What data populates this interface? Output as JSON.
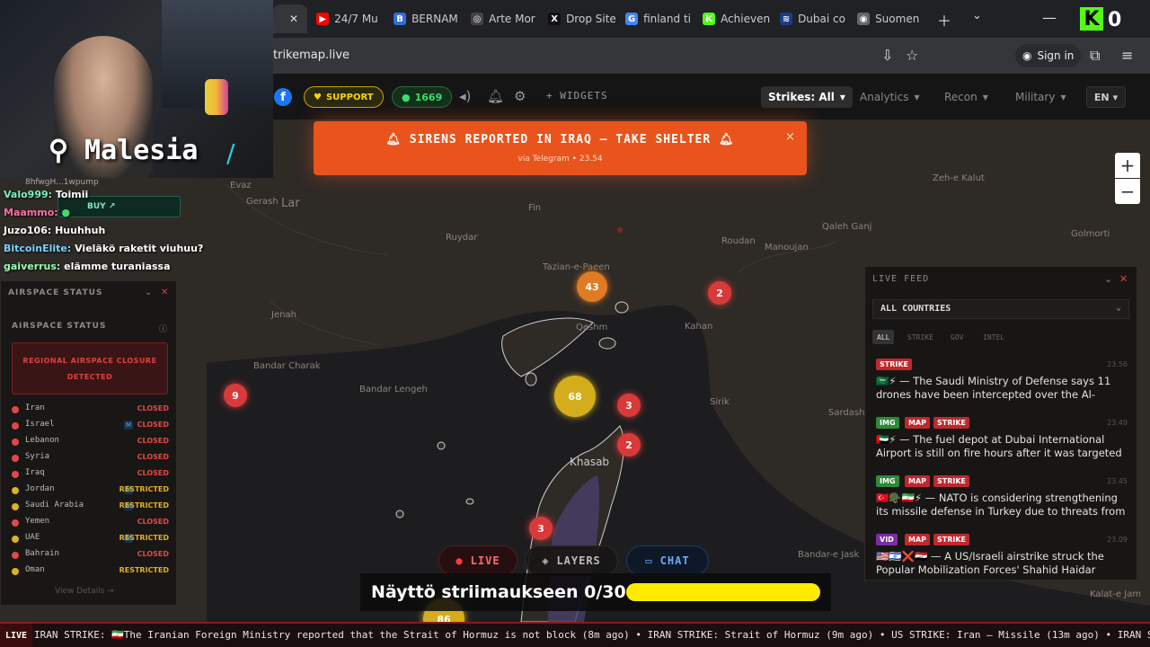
{
  "browser": {
    "tabs": [
      {
        "label": "",
        "color": "#e53935",
        "glyph": "",
        "active": true
      },
      {
        "label": "24/7 Mu",
        "color": "#ff0000",
        "glyph": "▶"
      },
      {
        "label": "BERNAM",
        "color": "#2f6fd6",
        "glyph": "B"
      },
      {
        "label": "Arte Mor",
        "color": "#444",
        "glyph": "◎"
      },
      {
        "label": "Drop Site",
        "color": "#111",
        "glyph": "X"
      },
      {
        "label": "finland ti",
        "color": "#4285f4",
        "glyph": "G"
      },
      {
        "label": "Achieven",
        "color": "#53fc18",
        "glyph": "K"
      },
      {
        "label": "Dubai co",
        "color": "#1a3c8a",
        "glyph": "≋"
      },
      {
        "label": "Suomen",
        "color": "#666",
        "glyph": "◉"
      }
    ],
    "url": "trikemap.live",
    "sign_in": "Sign in",
    "kick_count": "0"
  },
  "header": {
    "support": "SUPPORT",
    "online_count": "1669",
    "widgets": "+ WIDGETS",
    "nav": [
      {
        "label": "Strikes: All",
        "active": true
      },
      {
        "label": "Analytics"
      },
      {
        "label": "Recon"
      },
      {
        "label": "Military"
      }
    ],
    "lang": "EN"
  },
  "alert": {
    "title": "SIRENS REPORTED IN IRAQ — TAKE SHELTER",
    "sub": "via Telegram • 23.54",
    "close": "×"
  },
  "map": {
    "places": [
      {
        "name": "Evaz"
      },
      {
        "name": "Gerash"
      },
      {
        "name": "Lar"
      },
      {
        "name": "Fin"
      },
      {
        "name": "Ruydar"
      },
      {
        "name": "Tazian-e-Paeen"
      },
      {
        "name": "Roudan"
      },
      {
        "name": "Manoujan"
      },
      {
        "name": "Qaleh Ganj"
      },
      {
        "name": "Zeh-e Kalut"
      },
      {
        "name": "Golmorti"
      },
      {
        "name": "Jenah"
      },
      {
        "name": "Bandar Charak"
      },
      {
        "name": "Bandar Lengeh"
      },
      {
        "name": "Sardasht"
      },
      {
        "name": "Qeshm"
      },
      {
        "name": "Khasab"
      },
      {
        "name": "Bandar-e Jask"
      },
      {
        "name": "Kalat-e Jam"
      },
      {
        "name": "Sirik"
      },
      {
        "name": "Kahan"
      }
    ],
    "clusters": [
      {
        "count": "43",
        "color": "#e07a24"
      },
      {
        "count": "2",
        "color": "#d83a3a"
      },
      {
        "count": "68",
        "color": "#d4ad1c"
      },
      {
        "count": "3",
        "color": "#d83a3a"
      },
      {
        "count": "2",
        "color": "#d83a3a"
      },
      {
        "count": "9",
        "color": "#d83a3a"
      },
      {
        "count": "3",
        "color": "#d83a3a"
      },
      {
        "count": "86",
        "color": "#d4ad1c"
      }
    ],
    "zoom_in": "+",
    "zoom_out": "−"
  },
  "webcam": {
    "label": "⚲ Malesia"
  },
  "chat": {
    "top": "8hfwgH...1wpump",
    "buy": "BUY ↗",
    "messages": [
      {
        "user": "Valo999:",
        "text": "Toimii",
        "color": "#7cf0c0"
      },
      {
        "user": "Maammo:",
        "text": "",
        "color": "#ff6ea8"
      },
      {
        "user": "Juzo106:",
        "text": "Huuhhuh",
        "color": "#ffffff"
      },
      {
        "user": "BitcoinElite:",
        "text": "Vieläkö raketit viuhuu?",
        "color": "#7cd3ff"
      },
      {
        "user": "gaiverrus:",
        "text": "elämme turaniassa",
        "color": "#9affb0"
      }
    ]
  },
  "airspace": {
    "panel_title": "AIRSPACE STATUS",
    "section_title": "AIRSPACE STATUS",
    "alert_line1": "REGIONAL AIRSPACE CLOSURE",
    "alert_line2": "DETECTED",
    "view_details": "View Details →",
    "countries": [
      {
        "name": "Iran",
        "status": "CLOSED",
        "m": false
      },
      {
        "name": "Israel",
        "status": "CLOSED",
        "m": true
      },
      {
        "name": "Lebanon",
        "status": "CLOSED",
        "m": false
      },
      {
        "name": "Syria",
        "status": "CLOSED",
        "m": false
      },
      {
        "name": "Iraq",
        "status": "CLOSED",
        "m": false
      },
      {
        "name": "Jordan",
        "status": "RESTRICTED",
        "m": true
      },
      {
        "name": "Saudi Arabia",
        "status": "RESTRICTED",
        "m": true
      },
      {
        "name": "Yemen",
        "status": "CLOSED",
        "m": false
      },
      {
        "name": "UAE",
        "status": "RESTRICTED",
        "m": true
      },
      {
        "name": "Bahrain",
        "status": "CLOSED",
        "m": false
      },
      {
        "name": "Oman",
        "status": "RESTRICTED",
        "m": false
      }
    ],
    "colors": {
      "CLOSED": "#e04848",
      "RESTRICTED": "#e0b020"
    }
  },
  "feed": {
    "title": "LIVE FEED",
    "filter": "ALL COUNTRIES",
    "tabs": [
      "ALL",
      "STRIKE",
      "GOV",
      "INTEL"
    ],
    "entries": [
      {
        "tags": [
          "STRIKE"
        ],
        "time": "23.56",
        "text": "🇸🇦⚡ — The Saudi Ministry of Defense says 11 drones have been intercepted over the Al-Kharj..."
      },
      {
        "tags": [
          "IMG",
          "MAP",
          "STRIKE"
        ],
        "time": "23.49",
        "text": "🇦🇪⚡ — The fuel depot at Dubai International Airport is still on fire hours after it was targeted in..."
      },
      {
        "tags": [
          "IMG",
          "MAP",
          "STRIKE"
        ],
        "time": "23.45",
        "text": "🇹🇷🪖🇮🇷⚡ — NATO is considering strengthening its missile defense in Turkey due to threats from Iran,..."
      },
      {
        "tags": [
          "VID",
          "MAP",
          "STRIKE"
        ],
        "time": "23.09",
        "text": "🇺🇸🇮🇱❌🇮🇶 — A US/Israeli airstrike struck the Popular Mobilization Forces' Shahid Haidar checkpoint in..."
      }
    ],
    "tag_colors": {
      "STRIKE": "#c0282e",
      "IMG": "#2e8a3a",
      "MAP": "#c0282e",
      "VID": "#7a2ea0"
    }
  },
  "controls": {
    "live": "LIVE",
    "layers": "LAYERS",
    "chat": "CHAT"
  },
  "progress": {
    "label": "Näyttö striimaukseen 0/30",
    "value": 0,
    "max": 30
  },
  "ticker": {
    "live": "LIVE",
    "text": "IRAN STRIKE: 🇮🇷The Iranian Foreign Ministry reported that the Strait of Hormuz is not block (8m ago) • IRAN STRIKE: Strait of Hormuz (9m ago) • US STRIKE: Iran — Missile (13m ago) • IRAN STRIKE: 🇮🇷"
  }
}
